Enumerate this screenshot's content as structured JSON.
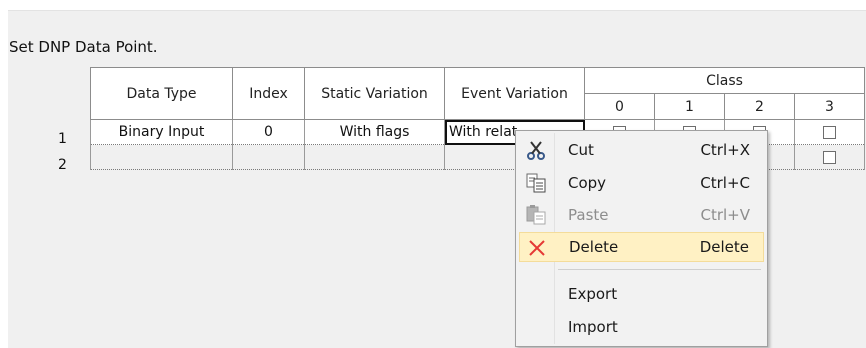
{
  "panel": {
    "title": "Set DNP Data Point."
  },
  "grid": {
    "headers": {
      "data_type": "Data Type",
      "index": "Index",
      "static_variation": "Static Variation",
      "event_variation": "Event Variation",
      "class": "Class",
      "class_columns": [
        "0",
        "1",
        "2",
        "3"
      ]
    },
    "rows": [
      {
        "num": "1",
        "data_type": "Binary Input",
        "index": "0",
        "static_variation": "With flags",
        "event_variation": "With relat"
      },
      {
        "num": "2",
        "data_type": "",
        "index": "",
        "static_variation": "",
        "event_variation": ""
      }
    ]
  },
  "context_menu": {
    "items": [
      {
        "label": "Cut",
        "shortcut": "Ctrl+X",
        "icon": "scissors-icon"
      },
      {
        "label": "Copy",
        "shortcut": "Ctrl+C",
        "icon": "copy-icon"
      },
      {
        "label": "Paste",
        "shortcut": "Ctrl+V",
        "icon": "paste-icon",
        "disabled": true
      },
      {
        "label": "Delete",
        "shortcut": "Delete",
        "icon": "delete-x-icon",
        "highlighted": true
      },
      {
        "label": "Export",
        "shortcut": ""
      },
      {
        "label": "Import",
        "shortcut": ""
      }
    ]
  },
  "colors": {
    "panel_bg": "#f0f0f0",
    "menu_highlight": "#fff1c4",
    "delete_icon": "#e53935",
    "scissors_icon": "#3a5a8a"
  }
}
